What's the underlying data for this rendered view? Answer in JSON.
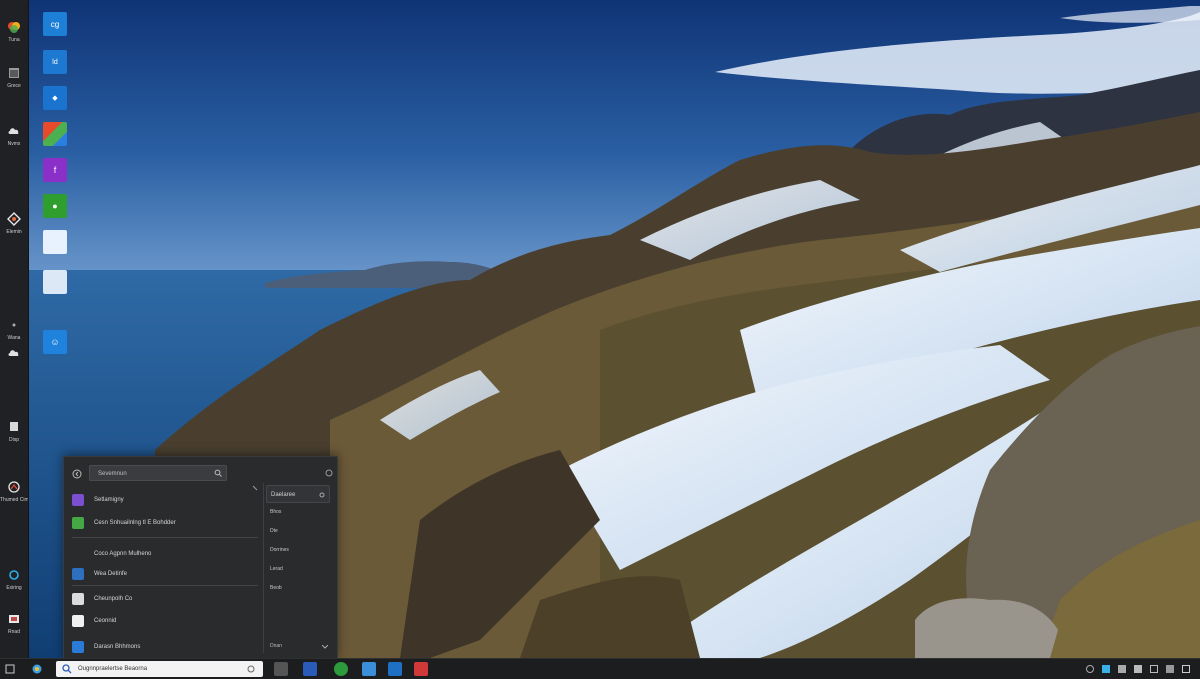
{
  "left_rail": {
    "items": [
      {
        "label": "Tuna",
        "icon": "color-app-icon"
      },
      {
        "label": "Grece",
        "icon": "window-icon"
      },
      {
        "label": "Nvmx",
        "icon": "cloud-icon"
      },
      {
        "label": "Elemin",
        "icon": "diamond-icon"
      },
      {
        "label": "Wana",
        "icon": "dot-icon"
      },
      {
        "label": "",
        "icon": "cloud-icon"
      },
      {
        "label": "Disp",
        "icon": "window-icon"
      },
      {
        "label": "Thumed Cimas",
        "icon": "circle-icon"
      },
      {
        "label": "Exiring",
        "icon": "ring-icon"
      },
      {
        "label": "Rnad",
        "icon": "tile-icon"
      }
    ]
  },
  "desktop_icons": [
    {
      "label": "",
      "glyph": "cg",
      "color": "#1e7fd6"
    },
    {
      "label": "",
      "glyph": "ld",
      "color": "#1c78d1"
    },
    {
      "label": "",
      "glyph": "◆",
      "color": "#1a74cf"
    },
    {
      "label": "",
      "glyph": "",
      "color": "#2f8a3a"
    },
    {
      "label": "",
      "glyph": "f",
      "color": "#8a2fc8"
    },
    {
      "label": "",
      "glyph": "●",
      "color": "#2e9f2e"
    },
    {
      "label": "",
      "glyph": "",
      "color": "#e8f2ff"
    },
    {
      "label": "",
      "glyph": "",
      "color": "#dce8f5"
    },
    {
      "label": "",
      "glyph": "☺",
      "color": "#1f82dd"
    }
  ],
  "start_panel": {
    "search_placeholder": "Sevemnun",
    "rows": [
      {
        "label": "Setlamigny",
        "color": "#7a4fd0"
      },
      {
        "label": "Cesn Snhuailnlng tl E Bohdder",
        "color": "#45a845"
      },
      {
        "label": "Coco Agpnn Mulheno",
        "color": "#4a4a4a"
      },
      {
        "label": "Wea Detinfe",
        "color": "#2e6fbf"
      },
      {
        "label": "Cheunpolh Co",
        "color": "#dcdcdc"
      },
      {
        "label": "Ceonnid",
        "color": "#f0f0f0"
      },
      {
        "label": "Darasn Bhhmons",
        "color": "#2a7bd8"
      }
    ],
    "right_header": "Daelaree",
    "right_items": [
      "Bhos",
      "Dte",
      "Dorrines",
      "Lerad",
      "Beob"
    ],
    "footer_right": "Dnan"
  },
  "taskbar": {
    "search_text": "Ougnnpraelertse Beaorna",
    "apps": [
      {
        "name": "task-view-icon",
        "color": "#555"
      },
      {
        "name": "app-blue-icon",
        "color": "#2a5bb8"
      },
      {
        "name": "app-green-icon",
        "color": "#2d9b3b"
      },
      {
        "name": "app-window-icon",
        "color": "#3a8fd8"
      },
      {
        "name": "app-store-icon",
        "color": "#1f6fc4"
      },
      {
        "name": "app-red-icon",
        "color": "#d13838"
      }
    ]
  },
  "colors": {
    "sky_top": "#113a7a",
    "sky_horizon": "#5d8fc6",
    "sea": "#1f5c9a",
    "rail_bg": "#202124",
    "panel_bg": "#2a2b2d",
    "taskbar_bg": "#1c1d1f"
  }
}
